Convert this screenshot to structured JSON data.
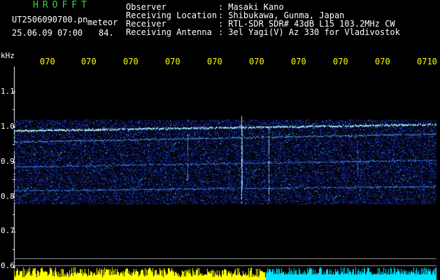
{
  "header": {
    "title": "HROFFT",
    "filename": "UT2506090700.pn",
    "meteor_label": "meteor",
    "datetime": "25.06.09 07:00",
    "value": "84."
  },
  "info": [
    {
      "label": "Observer",
      "sep": ":",
      "value": "Masaki Kano"
    },
    {
      "label": "Receiving Location",
      "sep": ":",
      "value": "Shibukawa, Gunma, Japan"
    },
    {
      "label": "Receiver",
      "sep": ":",
      "value": "RTL-SDR SDR# 43dB L15 103.2MHz CW"
    },
    {
      "label": "Receiving Antenna",
      "sep": ":",
      "value": "3el Yagi(V) Az 330 for Vladivostok"
    }
  ],
  "axis": {
    "unit": "kHz",
    "y_ticks": [
      "1.1",
      "1.0",
      "0.9",
      "0.8",
      "0.7",
      "0.6"
    ],
    "x_ticks": [
      "070",
      "070",
      "070",
      "070",
      "070",
      "070",
      "070",
      "070",
      "070",
      "0710"
    ]
  },
  "colors": {
    "label_green": "#3cd23c",
    "tick_yellow": "#ffff00",
    "signal_blue": "#2040ff",
    "signal_cyan": "#60e0ff",
    "baseline_cyan": "#00e5ff"
  }
}
